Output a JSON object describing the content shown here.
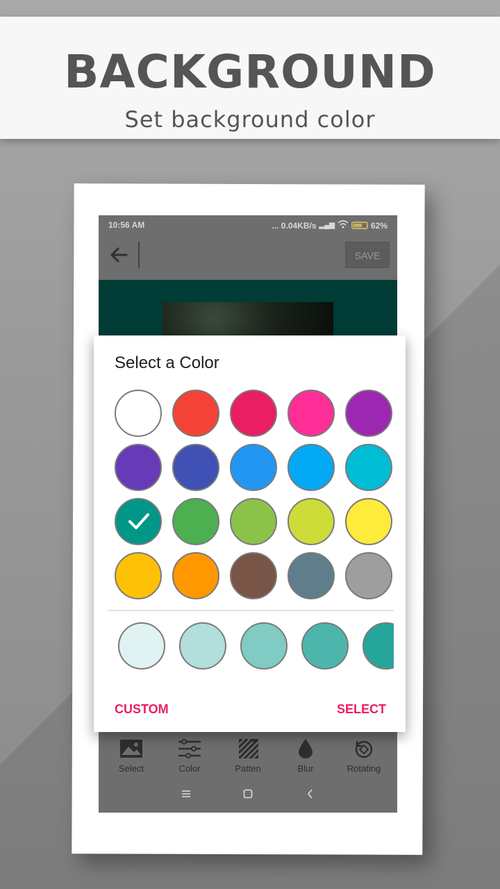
{
  "promo": {
    "title": "BACKGROUND",
    "subtitle": "Set background color"
  },
  "status_bar": {
    "time": "10:56 AM",
    "network": "... 0.04KB/s",
    "battery": "62%"
  },
  "toolbar": {
    "back_icon": "arrow-left-icon",
    "save_label": "SAVE"
  },
  "dialog": {
    "title": "Select a Color",
    "custom_label": "CUSTOM",
    "select_label": "SELECT",
    "colors": [
      "#ffffff",
      "#f44336",
      "#e91e63",
      "#ff2d96",
      "#9c27b0",
      "#673ab7",
      "#3f51b5",
      "#2196f3",
      "#03a9f4",
      "#00bcd4",
      "#009688",
      "#4caf50",
      "#8bc34a",
      "#cddc39",
      "#ffeb3b",
      "#ffc107",
      "#ff9800",
      "#795548",
      "#607d8b",
      "#9e9e9e"
    ],
    "selected_color": "#009688",
    "shades": [
      "#e0f2f1",
      "#b2dfdb",
      "#80cbc4",
      "#4db6ac",
      "#26a69a"
    ]
  },
  "tools": [
    {
      "label": "Select",
      "icon": "image-icon"
    },
    {
      "label": "Color",
      "icon": "sliders-icon"
    },
    {
      "label": "Patten",
      "icon": "pattern-icon"
    },
    {
      "label": "Blur",
      "icon": "drop-icon"
    },
    {
      "label": "Rotating",
      "icon": "rotate-icon"
    }
  ],
  "nav": {
    "menu_icon": "menu-icon",
    "home_icon": "home-icon",
    "back_icon": "chevron-left-icon"
  }
}
